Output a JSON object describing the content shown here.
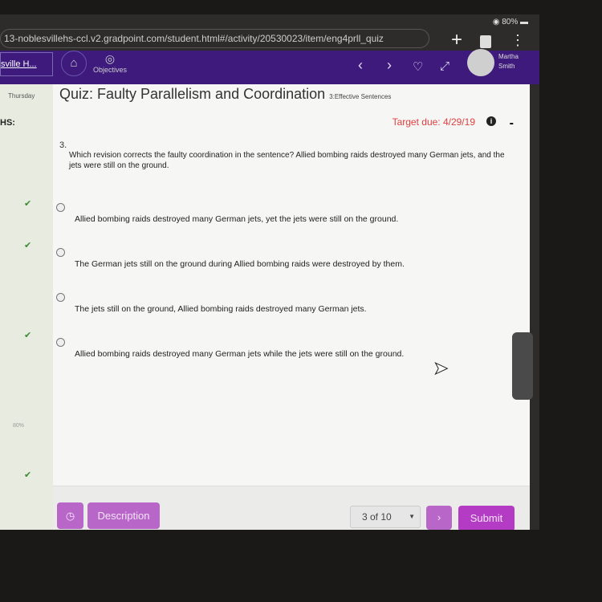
{
  "status": {
    "battery": "80%"
  },
  "browser": {
    "url": "13-noblesvillehs-ccl.v2.gradpoint.com/student.html#/activity/20530023/item/eng4prll_quiz"
  },
  "nav": {
    "school": "sville H...",
    "objectives": "Objectives",
    "user_first": "Martha",
    "user_last": "Smith"
  },
  "sidebar": {
    "day": "Thursday",
    "heading": "HS:",
    "progress": "80%"
  },
  "quiz": {
    "title": "Quiz: Faulty Parallelism and Coordination",
    "subtitle": "3:Effective Sentences",
    "target_due": "Target due: 4/29/19",
    "question_number": "3.",
    "question": "Which revision corrects the faulty coordination in the sentence? Allied bombing raids destroyed many German jets, and the jets were still on the ground.",
    "options": [
      "Allied bombing raids destroyed many German jets, yet the jets were still on the ground.",
      "The German jets still on the ground during Allied bombing raids were destroyed by them.",
      "The jets still on the ground, Allied bombing raids destroyed many German jets.",
      "Allied bombing raids destroyed many German jets while the jets were still on the ground."
    ]
  },
  "footer": {
    "description": "Description",
    "page_select": "3 of 10",
    "submit": "Submit"
  },
  "colors": {
    "nav": "#3d1a7c",
    "button": "#b866c8",
    "due": "#e04040"
  }
}
